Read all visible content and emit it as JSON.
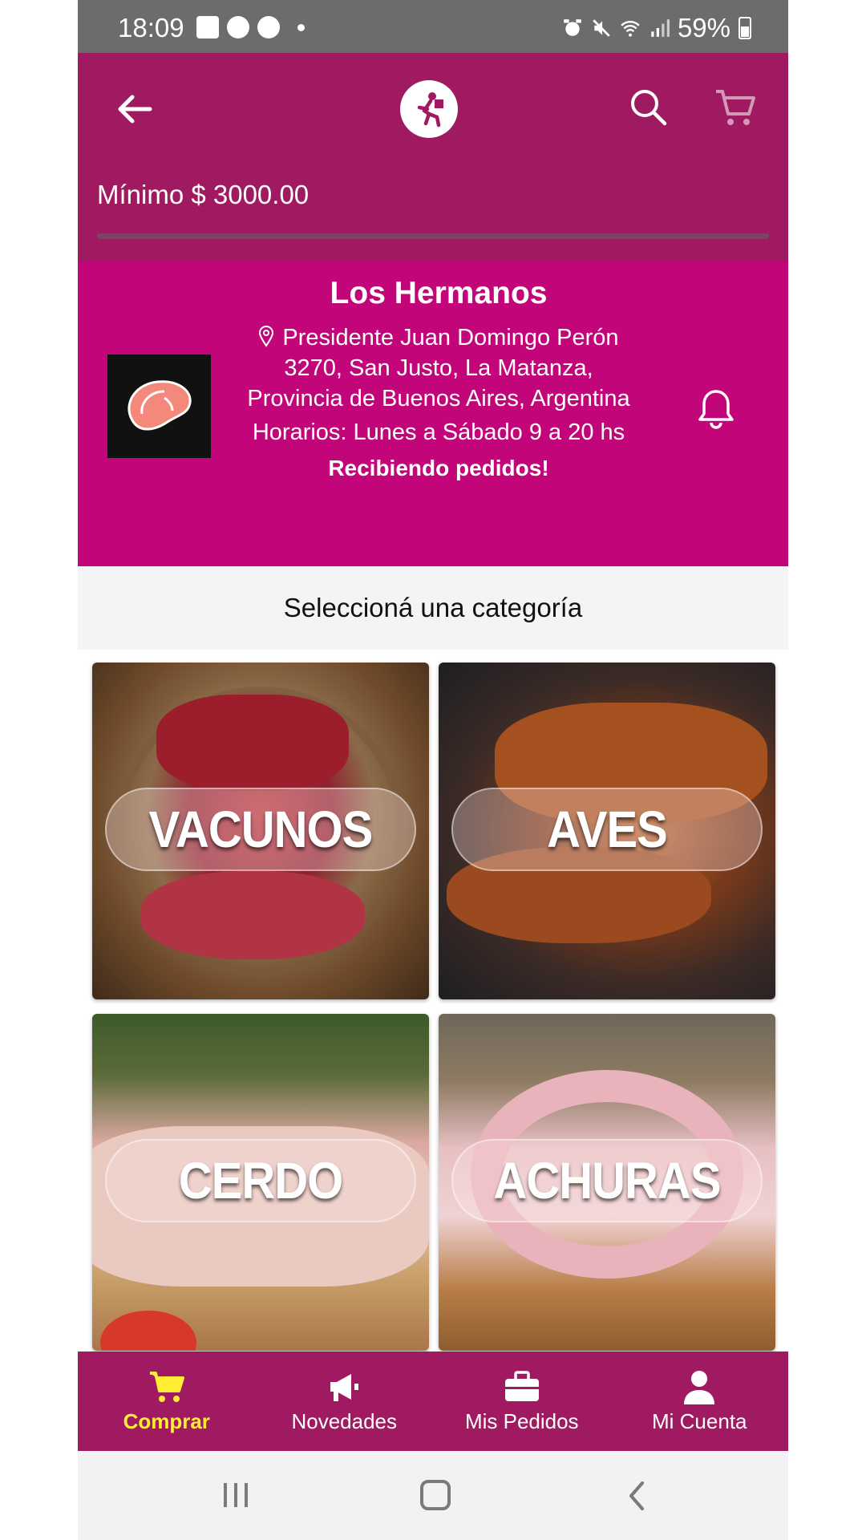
{
  "status_bar": {
    "time": "18:09",
    "battery": "59%",
    "left_icons": [
      "gallery-icon",
      "globe-icon",
      "globe-icon"
    ],
    "right_icons": [
      "alarm-icon",
      "mute-icon",
      "wifi-icon",
      "signal-icon",
      "battery-icon"
    ]
  },
  "app_bar": {
    "minimum_order": "Mínimo $ 3000.00",
    "progress_fraction": 0.0,
    "icons": [
      "back-arrow-icon",
      "delivery-runner-logo",
      "search-icon",
      "cart-icon"
    ]
  },
  "store": {
    "name": "Los Hermanos",
    "address": "Presidente Juan Domingo Perón 3270, San Justo, La Matanza, Provincia de Buenos Aires, Argentina",
    "hours": "Horarios: Lunes a Sábado 9 a 20 hs",
    "status": "Recibiendo pedidos!",
    "image_icon": "steak-icon"
  },
  "categories_title": "Seleccioná una categoría",
  "categories": [
    {
      "label": "VACUNOS"
    },
    {
      "label": "AVES"
    },
    {
      "label": "CERDO"
    },
    {
      "label": "ACHURAS"
    }
  ],
  "bottom_nav": [
    {
      "label": "Comprar",
      "icon": "cart-icon",
      "active": true
    },
    {
      "label": "Novedades",
      "icon": "megaphone-icon",
      "active": false
    },
    {
      "label": "Mis Pedidos",
      "icon": "briefcase-icon",
      "active": false
    },
    {
      "label": "Mi Cuenta",
      "icon": "user-icon",
      "active": false
    }
  ],
  "colors": {
    "app_bar": "#a01a62",
    "store_header": "#c2067a",
    "active_nav": "#ffee33"
  }
}
